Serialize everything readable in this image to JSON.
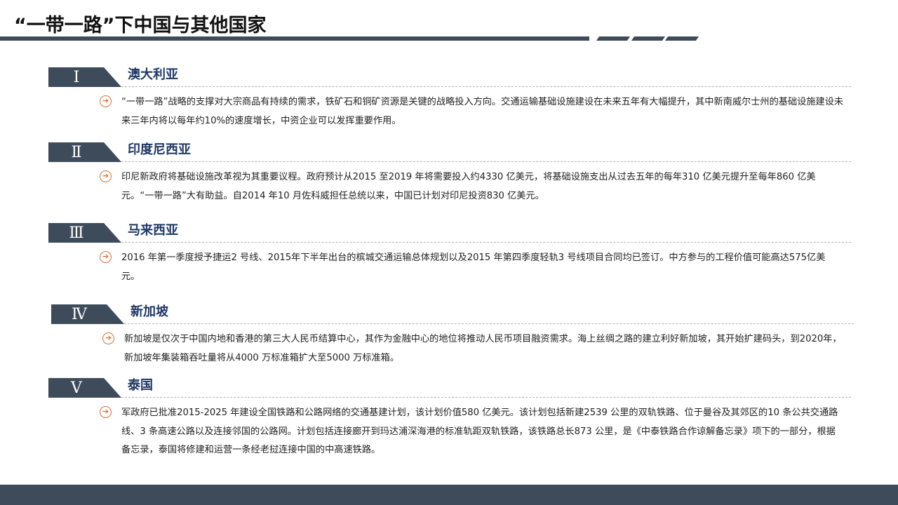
{
  "title": "“一带一路”下中国与其他国家",
  "sections": [
    {
      "numeral": "Ⅰ",
      "country": "澳大利亚",
      "text": " “一带一路”战略的支撑对大宗商品有持续的需求，铁矿石和铜矿资源是关键的战略投入方向。交通运输基础设施建设在未来五年有大幅提升，其中新南威尔士州的基础设施建设未来三年内将以每年约10%的速度增长，中资企业可以发挥重要作用。"
    },
    {
      "numeral": "Ⅱ",
      "country": "印度尼西亚",
      "text": "印尼新政府将基础设施改革视为其重要议程。政府预计从2015 至2019 年将需要投入约4330 亿美元，将基础设施支出从过去五年的每年310 亿美元提升至每年860 亿美元。“一带一路”大有助益。自2014 年10 月佐科威担任总统以来，中国已计划对印尼投资830 亿美元。"
    },
    {
      "numeral": "Ⅲ",
      "country": "马来西亚",
      "text": "2016 年第一季度授予捷运2 号线、2015年下半年出台的槟城交通运输总体规划以及2015 年第四季度轻轨3 号线项目合同均已签订。中方参与的工程价值可能高达575亿美元。"
    },
    {
      "numeral": "Ⅳ",
      "country": "新加坡",
      "text": "新加坡是仅次于中国内地和香港的第三大人民币结算中心，其作为金融中心的地位将推动人民币项目融资需求。海上丝绸之路的建立利好新加坡，其开始扩建码头，到2020年，新加坡年集装箱吞吐量将从4000 万标准箱扩大至5000 万标准箱。"
    },
    {
      "numeral": "Ⅴ",
      "country": "泰国",
      "text": "军政府已批准2015-2025 年建设全国铁路和公路网络的交通基建计划，该计划价值580 亿美元。该计划包括新建2539 公里的双轨铁路、位于曼谷及其郊区的10 条公共交通路线、3 条高速公路以及连接邻国的公路网。计划包括连接廊开到玛达浦深海港的标准轨距双轨铁路，该铁路总长873 公里，是《中泰铁路合作谅解备忘录》项下的一部分，根据备忘录，泰国将修建和运营一条经老挝连接中国的中高速铁路。"
    }
  ]
}
